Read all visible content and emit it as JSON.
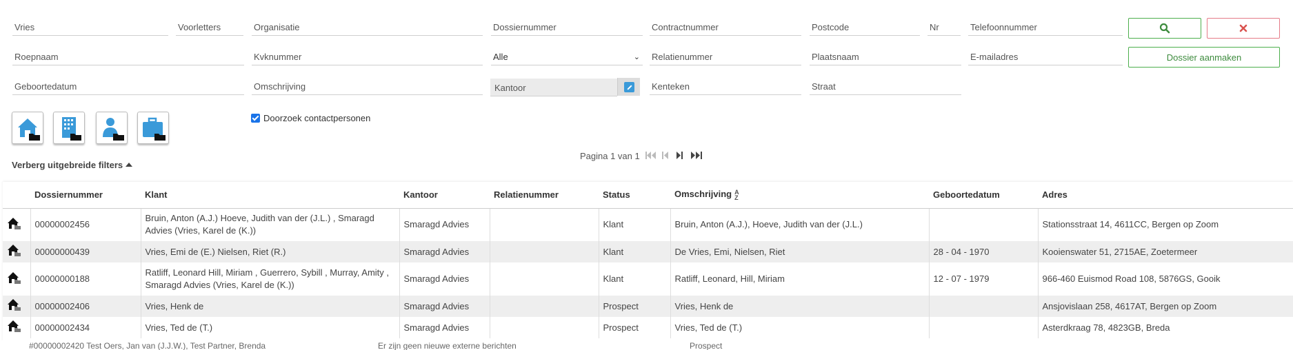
{
  "search": {
    "vries": "Vries",
    "voorletters": "Voorletters",
    "organisatie": "Organisatie",
    "dossiernummer": "Dossiernummer",
    "contractnummer": "Contractnummer",
    "postcode": "Postcode",
    "nr": "Nr",
    "telefoonnummer": "Telefoonnummer",
    "roepnaam": "Roepnaam",
    "kvknummer": "Kvknummer",
    "status_select": "Alle",
    "relatienummer": "Relatienummer",
    "plaatsnaam": "Plaatsnaam",
    "emailadres": "E-mailadres",
    "geboortedatum": "Geboortedatum",
    "omschrijving": "Omschrijving",
    "kantoor": "Kantoor",
    "kenteken": "Kenteken",
    "straat": "Straat"
  },
  "buttons": {
    "search_icon": "search-icon",
    "clear_icon": "close-icon",
    "create_label": "Dossier aanmaken"
  },
  "type_buttons": [
    "home-folder-icon",
    "building-folder-icon",
    "person-folder-icon",
    "briefcase-folder-icon"
  ],
  "checkbox": {
    "label": "Doorzoek contactpersonen",
    "checked": true
  },
  "pager": {
    "label": "Pagina 1 van 1"
  },
  "advanced_toggle": "Verberg uitgebreide filters",
  "table": {
    "headers": [
      "Dossiernummer",
      "Klant",
      "Kantoor",
      "Relatienummer",
      "Status",
      "Omschrijving",
      "Geboortedatum",
      "Adres"
    ],
    "rows": [
      {
        "dossier": "00000002456",
        "klant": "Bruin, Anton (A.J.) Hoeve, Judith van der (J.L.) , Smaragd Advies (Vries, Karel de (K.))",
        "kantoor": "Smaragd Advies",
        "relatie": "",
        "status": "Klant",
        "omschrijving": "Bruin, Anton (A.J.), Hoeve, Judith van der (J.L.)",
        "geboorte": "",
        "adres": "Stationsstraat 14, 4611CC, Bergen op Zoom"
      },
      {
        "dossier": "00000000439",
        "klant": "Vries, Emi de (E.) Nielsen, Riet (R.)",
        "kantoor": "Smaragd Advies",
        "relatie": "",
        "status": "Klant",
        "omschrijving": "De Vries, Emi, Nielsen, Riet",
        "geboorte": "28 - 04 - 1970",
        "adres": "Kooienswater 51, 2715AE, Zoetermeer"
      },
      {
        "dossier": "00000000188",
        "klant": "Ratliff, Leonard Hill, Miriam , Guerrero, Sybill , Murray, Amity , Smaragd Advies (Vries, Karel de (K.))",
        "kantoor": "Smaragd Advies",
        "relatie": "",
        "status": "Klant",
        "omschrijving": "Ratliff, Leonard, Hill, Miriam",
        "geboorte": "12 - 07 - 1979",
        "adres": "966-460 Euismod Road 108, 5876GS, Gooik"
      },
      {
        "dossier": "00000002406",
        "klant": "Vries, Henk de",
        "kantoor": "Smaragd Advies",
        "relatie": "",
        "status": "Prospect",
        "omschrijving": "Vries, Henk de",
        "geboorte": "",
        "adres": "Ansjovislaan 258, 4617AT, Bergen op Zoom"
      },
      {
        "dossier": "00000002434",
        "klant": "Vries, Ted de (T.)",
        "kantoor": "Smaragd Advies",
        "relatie": "",
        "status": "Prospect",
        "omschrijving": "Vries, Ted de (T.)",
        "geboorte": "",
        "adres": "Asterdkraag 78, 4823GB, Breda"
      }
    ]
  },
  "bottom_strip": {
    "left_text": "#00000002420   Test Oers, Jan van (J.J.W.), Test Partner, Brenda",
    "mid_text": "Er zijn geen nieuwe externe berichten",
    "right_text": "Prospect"
  },
  "colors": {
    "accent_green": "#4cae4c",
    "accent_red": "#d9534f",
    "icon_blue": "#3a9ad9"
  }
}
